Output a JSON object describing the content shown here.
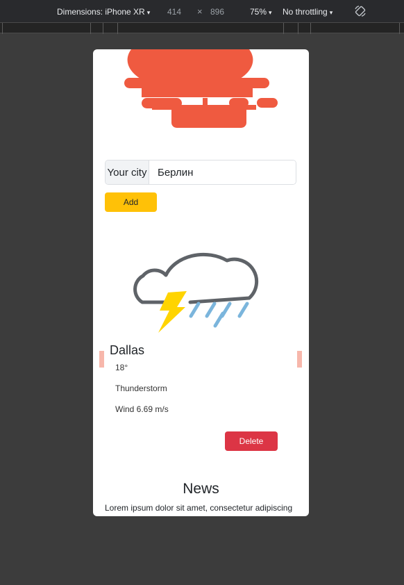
{
  "devtools": {
    "device_label": "Dimensions: iPhone XR",
    "width": "414",
    "times": "×",
    "height": "896",
    "zoom": "75%",
    "throttling": "No throttling",
    "caret": "▾"
  },
  "app": {
    "hero_icon": "sun-fog-icon",
    "city_form": {
      "label": "Your city",
      "value": "Берлин",
      "add_label": "Add"
    },
    "weather_card": {
      "icon": "thunderstorm-icon",
      "city": "Dallas",
      "temperature": "18°",
      "condition": "Thunderstorm",
      "wind": "Wind 6.69 m/s",
      "delete_label": "Delete"
    },
    "news": {
      "title": "News",
      "text": "Lorem ipsum dolor sit amet, consectetur adipiscing"
    }
  },
  "colors": {
    "sun": "#ef5a40",
    "cloud": "#5f6368",
    "bolt": "#ffd400",
    "rain": "#7bb5dc",
    "add_button": "#ffc107",
    "delete_button": "#dc3545"
  }
}
